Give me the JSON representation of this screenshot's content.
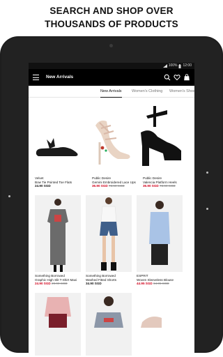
{
  "headline": {
    "line1": "SEARCH AND SHOP OVER",
    "line2": "THOUSANDS OF PRODUCTS"
  },
  "statusbar": {
    "battery": "100%",
    "time": "12:00"
  },
  "topbar": {
    "title": "New Arrivals"
  },
  "icons": {
    "menu": "hamburger-menu-icon",
    "search": "search-icon",
    "wishlist": "heart-icon",
    "bag": "shopping-bag-icon"
  },
  "tabs": [
    "New Arrivals",
    "Women's Clothing",
    "Women's Shoes"
  ],
  "colors": {
    "sale": "#d0021b",
    "bar": "#000000"
  },
  "products": [
    {
      "brand": "Velvet",
      "name": "Bow Tie Pointed Toe Flats",
      "price": "24.90 SGD",
      "old_price": ""
    },
    {
      "brand": "Public Desire",
      "name": "Gemini Embroidered Lace Ups",
      "price": "36.90 SGD",
      "old_price": "73.90 SGD"
    },
    {
      "brand": "Public Desire",
      "name": "Valencia Platform Heels",
      "price": "36.90 SGD",
      "old_price": "73.90 SGD"
    },
    {
      "brand": "Something Borrowed",
      "name": "Graphic High Slit T-Shirt Maxi",
      "price": "24.90 SGD",
      "old_price": "29.90 SGD"
    },
    {
      "brand": "Something Borrowed",
      "name": "Washed Fitted Shorts",
      "price": "34.90 SGD",
      "old_price": ""
    },
    {
      "brand": "ESPRIT",
      "name": "Woven Sleeveless Blouse",
      "price": "44.95 SGD",
      "old_price": "64.95 SGD"
    }
  ]
}
